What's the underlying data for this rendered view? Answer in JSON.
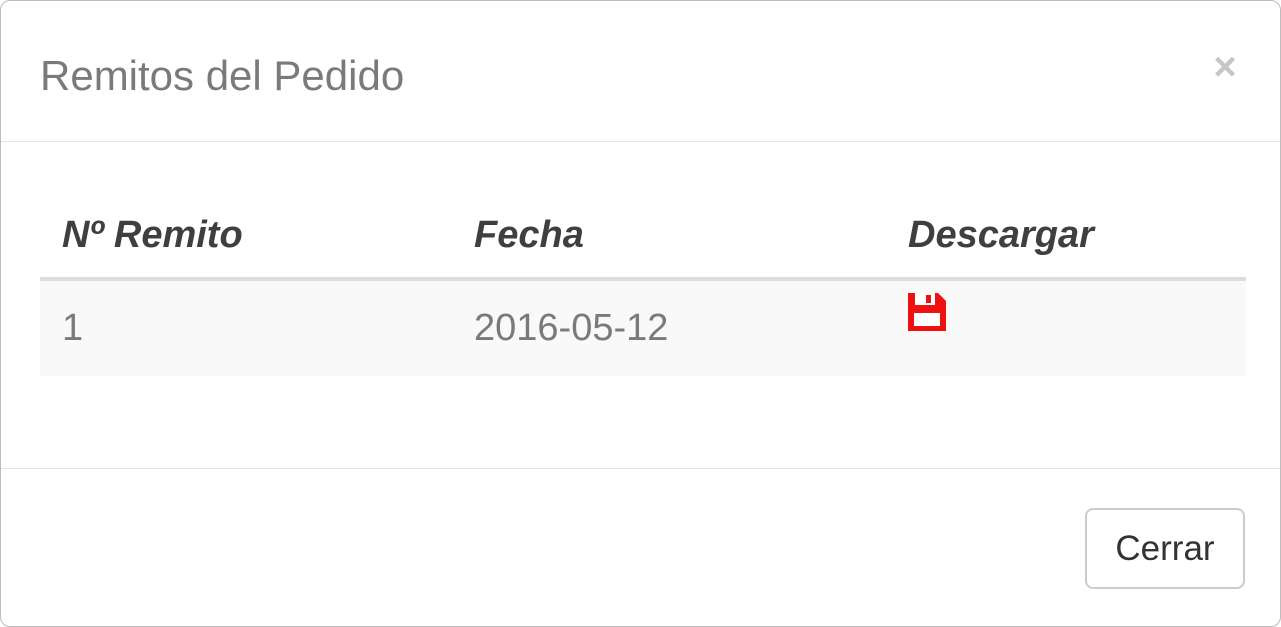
{
  "modal": {
    "title": "Remitos del Pedido",
    "close_label": "×"
  },
  "table": {
    "headers": [
      "Nº Remito",
      "Fecha",
      "Descargar"
    ],
    "rows": [
      {
        "numero": "1",
        "fecha": "2016-05-12",
        "descargar_icon": "floppy-disk-icon"
      }
    ]
  },
  "footer": {
    "close_button_label": "Cerrar"
  },
  "colors": {
    "download_icon": "#ee1111",
    "title_text": "#7a7a7a",
    "header_text": "#3f3f3f",
    "row_background": "#f9f9f9"
  }
}
